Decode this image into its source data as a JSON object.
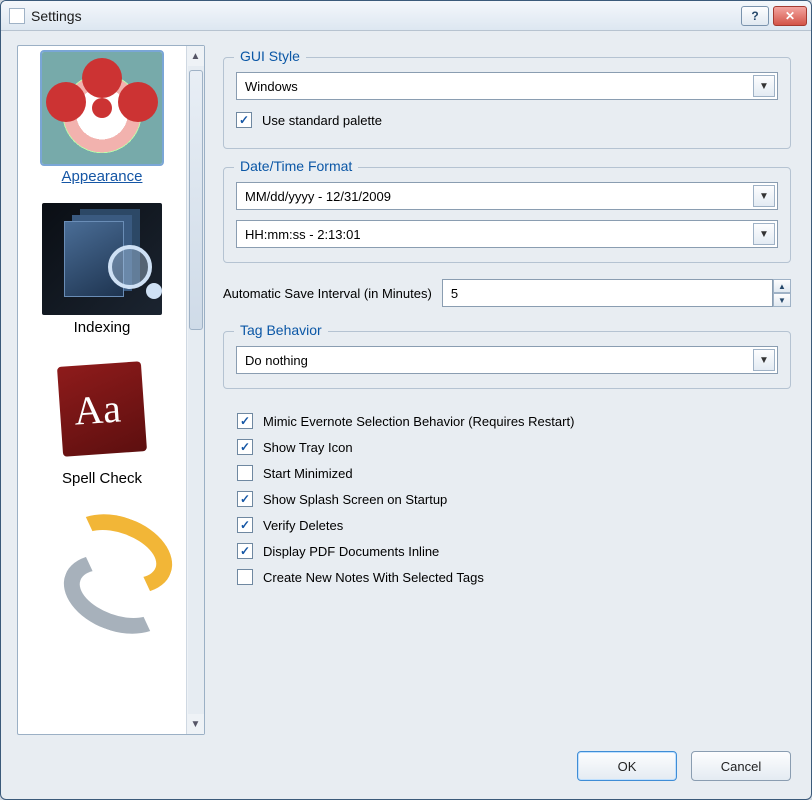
{
  "window": {
    "title": "Settings"
  },
  "sidebar": {
    "items": [
      {
        "label": "Appearance",
        "selected": true
      },
      {
        "label": "Indexing",
        "selected": false
      },
      {
        "label": "Spell Check",
        "selected": false
      },
      {
        "label": "",
        "selected": false
      }
    ]
  },
  "groups": {
    "gui_style": {
      "title": "GUI Style",
      "style_value": "Windows",
      "use_standard_palette": {
        "label": "Use standard palette",
        "checked": true
      }
    },
    "datetime": {
      "title": "Date/Time Format",
      "date_value": "MM/dd/yyyy - 12/31/2009",
      "time_value": "HH:mm:ss - 2:13:01"
    },
    "autosave": {
      "label": "Automatic Save Interval (in Minutes)",
      "value": "5"
    },
    "tag_behavior": {
      "title": "Tag Behavior",
      "value": "Do nothing"
    }
  },
  "checkboxes": [
    {
      "label": "Mimic Evernote Selection Behavior (Requires Restart)",
      "checked": true
    },
    {
      "label": "Show Tray Icon",
      "checked": true
    },
    {
      "label": "Start Minimized",
      "checked": false
    },
    {
      "label": "Show Splash Screen on Startup",
      "checked": true
    },
    {
      "label": "Verify Deletes",
      "checked": true
    },
    {
      "label": "Display PDF Documents Inline",
      "checked": true
    },
    {
      "label": "Create New Notes With Selected Tags",
      "checked": false
    }
  ],
  "buttons": {
    "ok": "OK",
    "cancel": "Cancel"
  }
}
